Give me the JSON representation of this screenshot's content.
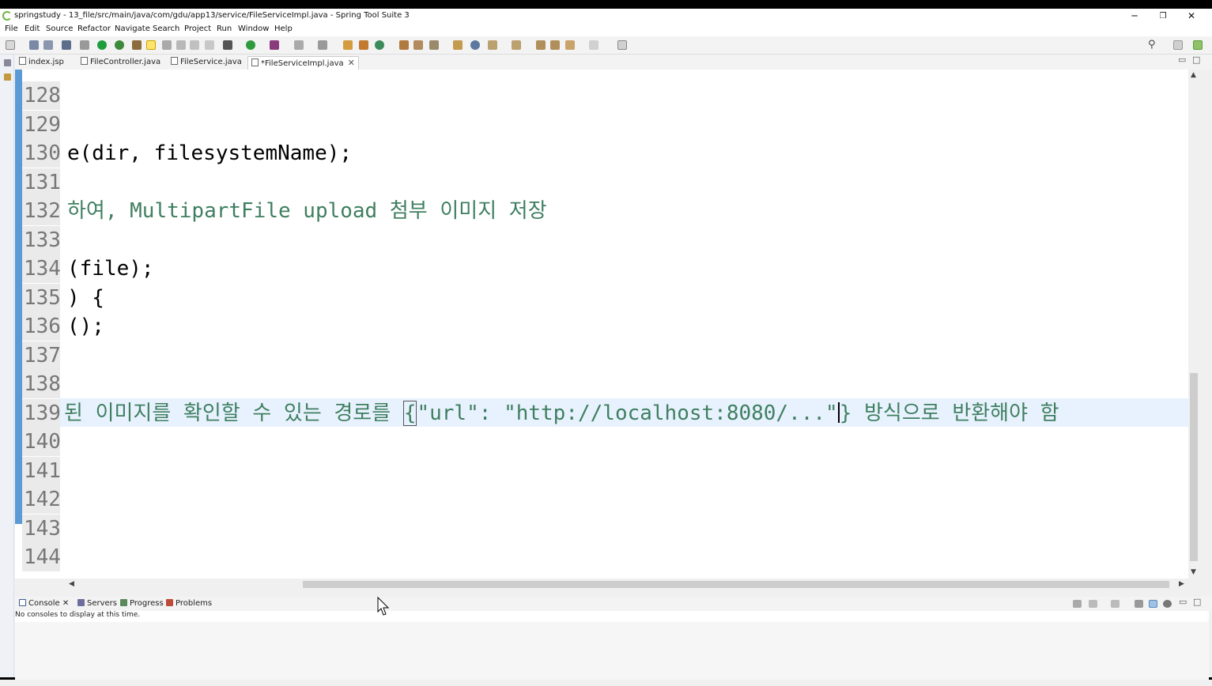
{
  "window": {
    "title": "springstudy - 13_file/src/main/java/com/gdu/app13/service/FileServiceImpl.java - Spring Tool Suite 3",
    "minimize": "─",
    "restore": "❐",
    "close": "✕"
  },
  "menu": [
    "File",
    "Edit",
    "Source",
    "Refactor",
    "Navigate",
    "Search",
    "Project",
    "Run",
    "Window",
    "Help"
  ],
  "tabs": [
    {
      "label": "index.jsp",
      "active": false
    },
    {
      "label": "FileController.java",
      "active": false
    },
    {
      "label": "FileService.java",
      "active": false
    },
    {
      "label": "*FileServiceImpl.java",
      "active": true
    }
  ],
  "editor": {
    "lines": [
      {
        "num": "128",
        "text": ""
      },
      {
        "num": "129",
        "text": ""
      },
      {
        "num": "130",
        "text": "e(dir, filesystemName);"
      },
      {
        "num": "131",
        "text": ""
      },
      {
        "num": "132",
        "text": "하여, MultipartFile upload 첨부 이미지 저장"
      },
      {
        "num": "133",
        "text": ""
      },
      {
        "num": "134",
        "text": "(file);"
      },
      {
        "num": "135",
        "text": ") {"
      },
      {
        "num": "136",
        "text": "();"
      },
      {
        "num": "137",
        "text": ""
      },
      {
        "num": "138",
        "text": ""
      },
      {
        "num": "139",
        "pre": "된 이미지를 확인할 수 있는 경로를 ",
        "brace_open": "{",
        "str1": "\"url\"",
        "mid": ": ",
        "str2": "\"http://localhost:8080/...\"",
        "brace_close": "}",
        "post": " 방식으로 반환해야 함"
      },
      {
        "num": "140",
        "text": ""
      },
      {
        "num": "141",
        "text": ""
      },
      {
        "num": "142",
        "text": ""
      },
      {
        "num": "143",
        "text": ""
      },
      {
        "num": "144",
        "text": ""
      }
    ]
  },
  "console": {
    "tabs": [
      "Console",
      "Servers",
      "Progress",
      "Problems"
    ],
    "message": "No consoles to display at this time."
  },
  "icons": {
    "search": "search-icon",
    "tab_close": "close-icon"
  },
  "colors": {
    "comment": "#3f7f5f",
    "string": "#2a00ff",
    "ruler": "#5b9bd5",
    "current_line": "#e8f2fe"
  }
}
